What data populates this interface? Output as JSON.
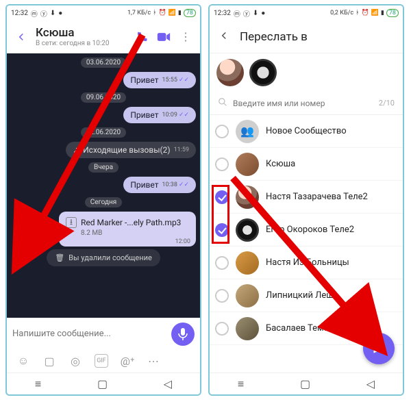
{
  "status": {
    "time": "12:32",
    "net_left": "1,7 КБ/с",
    "net_right": "0,2 КБ/с",
    "battery": "78"
  },
  "chat": {
    "title": "Ксюша",
    "subtitle": "В сети: сегодня в 10:20",
    "dates": {
      "d1": "03.06.2020",
      "d2": "09.06.2020",
      "d3": "12.06.2020",
      "yesterday": "Вчера",
      "today": "Сегодня"
    },
    "msgs": {
      "m1": {
        "text": "Привет",
        "time": "15:55"
      },
      "m2": {
        "text": "Привет",
        "time": "10:09"
      },
      "calls": {
        "text": "Исходящие вызовы(2)",
        "time": "11:59"
      },
      "m3": {
        "text": "Привет",
        "time": "10:38"
      },
      "file": {
        "name": "Red Marker -...ely Path.mp3",
        "size": "8.2 MB",
        "time": "12:00"
      },
      "deleted": "Вы удалили сообщение"
    },
    "compose_placeholder": "Напишите сообщение..."
  },
  "forward": {
    "title": "Переслать в",
    "search_placeholder": "Введите имя или номер",
    "counter": "2/10",
    "contacts": [
      {
        "name": "Новое Сообщество",
        "checked": false,
        "avatar": "community"
      },
      {
        "name": "Ксюша",
        "checked": false,
        "avatar": "photo1"
      },
      {
        "name": "Настя Тазарачева Теле2",
        "checked": true,
        "avatar": "girl"
      },
      {
        "name": "Егор Окороков Теле2",
        "checked": true,
        "avatar": "wheel"
      },
      {
        "name": "Настя Из Больницы",
        "checked": false,
        "avatar": "photo2"
      },
      {
        "name": "Липницкий Леша",
        "checked": false,
        "avatar": "photo3"
      },
      {
        "name": "Басалаев Тема",
        "checked": false,
        "avatar": "photo4"
      }
    ]
  }
}
